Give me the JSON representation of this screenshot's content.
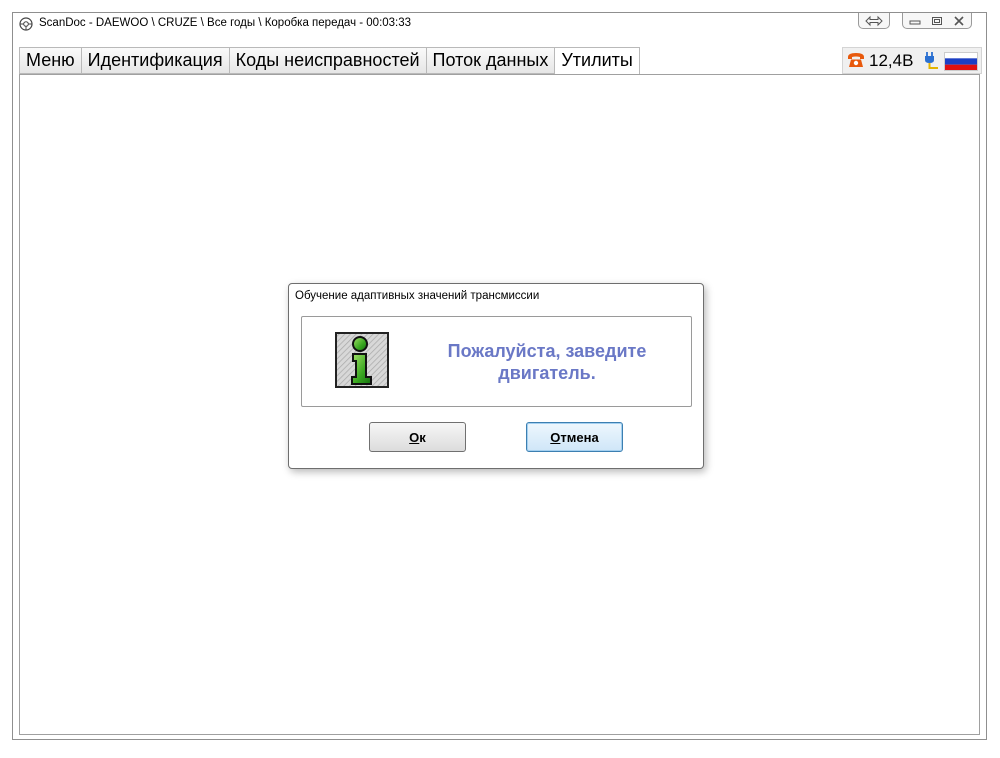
{
  "window": {
    "title": "ScanDoc - DAEWOO \\ CRUZE \\ Все годы \\ Коробка передач - 00:03:33"
  },
  "tabs": [
    {
      "label": "Меню"
    },
    {
      "label": "Идентификация"
    },
    {
      "label": "Коды неисправностей"
    },
    {
      "label": "Поток данных"
    },
    {
      "label": "Утилиты",
      "active": true
    }
  ],
  "status": {
    "voltage": "12,4В",
    "phone_icon": "phone-icon",
    "plug_icon": "plug-icon",
    "language_flag": "russia-flag-icon"
  },
  "dialog": {
    "title": "Обучение адаптивных значений трансмиссии",
    "message_line1": "Пожалуйста, заведите",
    "message_line2": "двигатель.",
    "ok_label": "Ок",
    "cancel_label": "Отмена",
    "message_color": "#6a78c6"
  }
}
